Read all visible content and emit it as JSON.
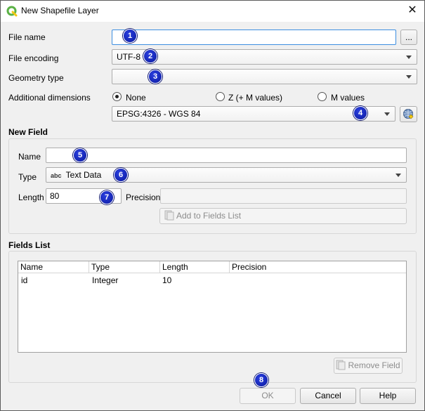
{
  "window": {
    "title": "New Shapefile Layer",
    "close_glyph": "✕"
  },
  "form": {
    "file_name_label": "File name",
    "file_name_value": "",
    "browse_label": "...",
    "file_encoding_label": "File encoding",
    "file_encoding_value": "UTF-8",
    "geometry_type_label": "Geometry type",
    "geometry_type_value": "",
    "additional_dimensions_label": "Additional dimensions",
    "dimension_options": [
      "None",
      "Z (+ M values)",
      "M values"
    ],
    "dimension_selected": "None",
    "crs_value": "EPSG:4326 - WGS 84"
  },
  "new_field": {
    "section_title": "New Field",
    "name_label": "Name",
    "name_value": "",
    "type_label": "Type",
    "type_badge": "abc",
    "type_value": "Text Data",
    "length_label": "Length",
    "length_value": "80",
    "precision_label": "Precision",
    "precision_value": "",
    "add_button_label": "Add to Fields List"
  },
  "fields_list": {
    "section_title": "Fields List",
    "columns": [
      "Name",
      "Type",
      "Length",
      "Precision"
    ],
    "rows": [
      {
        "name": "id",
        "type": "Integer",
        "length": "10",
        "precision": ""
      }
    ],
    "remove_button_label": "Remove Field"
  },
  "buttons": {
    "ok": "OK",
    "cancel": "Cancel",
    "help": "Help"
  },
  "badges": [
    "1",
    "2",
    "3",
    "4",
    "5",
    "6",
    "7",
    "8"
  ],
  "colors": {
    "badge_blue": "#0b1a9e",
    "focus_blue": "#3d8ee0",
    "qgis_green": "#5ab145",
    "qgis_yellow": "#f2c811"
  }
}
